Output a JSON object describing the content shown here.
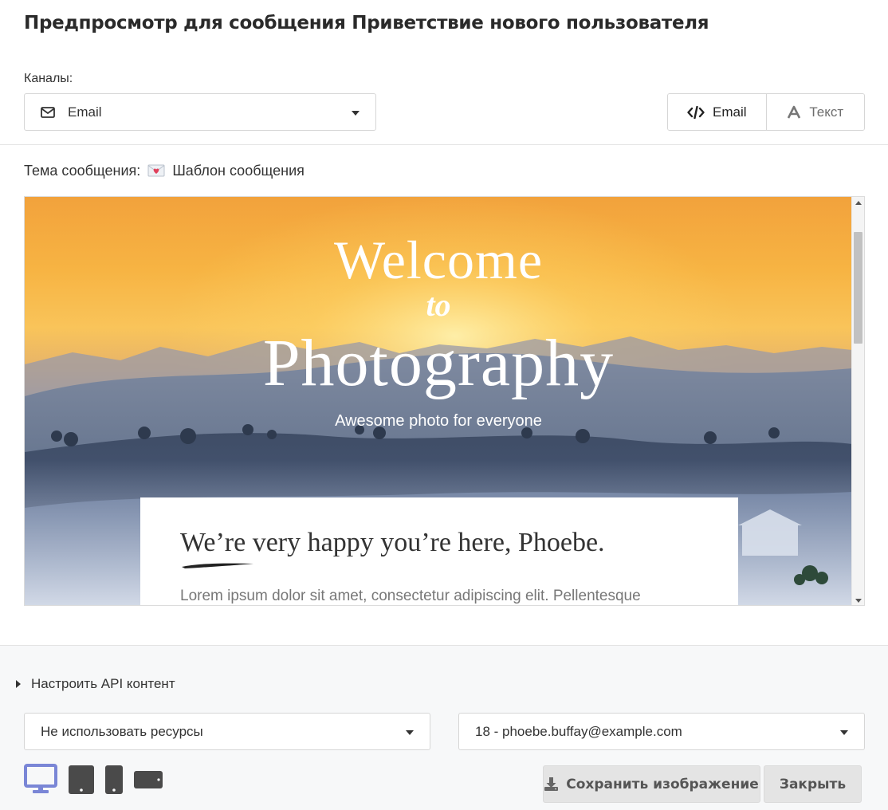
{
  "title": "Предпросмотр для сообщения Приветствие нового пользователя",
  "channels": {
    "label": "Каналы:",
    "selected": "Email"
  },
  "view_toggle": {
    "email_label": "Email",
    "text_label": "Текст"
  },
  "subject": {
    "label": "Тема сообщения:",
    "emoji": "love-letter-icon",
    "value": "Шаблон сообщения"
  },
  "preview": {
    "hero_welcome": "Welcome",
    "hero_to": "to",
    "hero_title": "Photography",
    "hero_subtitle": "Awesome photo for everyone",
    "card_heading": "We’re very happy you’re here, Phoebe.",
    "card_body": "Lorem ipsum dolor sit amet, consectetur adipiscing elit. Pellentesque"
  },
  "footer": {
    "api_toggle": "Настроить API контент",
    "resources_select": "Не использовать ресурсы",
    "user_select": "18 - phoebe.buffay@example.com",
    "save_button": "Сохранить изображение",
    "close_button": "Закрыть"
  },
  "devices": [
    {
      "name": "desktop",
      "active": true
    },
    {
      "name": "tablet",
      "active": false
    },
    {
      "name": "mobile",
      "active": false
    },
    {
      "name": "landscape",
      "active": false
    }
  ],
  "colors": {
    "active_device": "#7a86d6",
    "inactive_device": "#4a4a4a",
    "footer_bg": "#f7f8f9",
    "button_bg": "#e4e4e4"
  }
}
